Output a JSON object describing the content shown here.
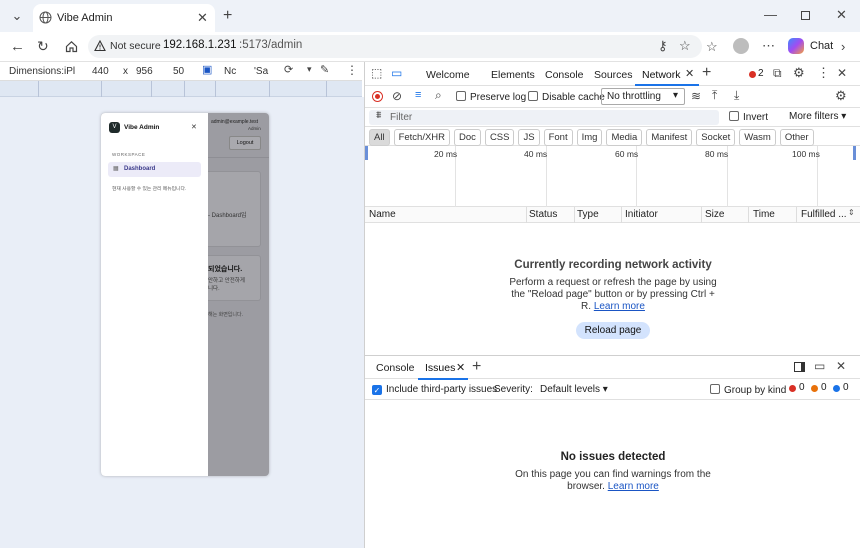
{
  "browser": {
    "tab_title": "Vibe Admin",
    "security_label": "Not secure",
    "url_host": "192.168.1.231",
    "url_rest": ":5173/admin",
    "chat_label": "Chat"
  },
  "device_toolbar": {
    "dimensions_label": "Dimensions:",
    "device": "iPl",
    "width": "440",
    "times": "x",
    "height": "956",
    "zoom": "50",
    "net": "Nc",
    "ua": "'Sa"
  },
  "app": {
    "brand": "Vibe Admin",
    "section_label": "WORKSPACE",
    "nav_item": "Dashboard",
    "drawer_note": "현재 사용할 수 있는 관리 메뉴입니다.",
    "user_email": "admin@example.test",
    "user_role": "Admin",
    "logout_label": "Logout",
    "card1_text": "- Dashboard입",
    "card2_title": "되었습니다.",
    "card2_line1": "안하고 안전하게",
    "card2_line2": "니다.",
    "footer_text": "해는 화면입니다."
  },
  "devtools": {
    "tabs": [
      "Welcome",
      "Elements",
      "Console",
      "Sources",
      "Network"
    ],
    "active_tab": "Network",
    "error_count": "2",
    "preserve_log": "Preserve log",
    "disable_cache": "Disable cache",
    "throttling": "No throttling",
    "filter_placeholder": "Filter",
    "invert": "Invert",
    "more_filters": "More filters",
    "type_filters": [
      "All",
      "Fetch/XHR",
      "Doc",
      "CSS",
      "JS",
      "Font",
      "Img",
      "Media",
      "Manifest",
      "Socket",
      "Wasm",
      "Other"
    ],
    "timeline_ticks": [
      "20 ms",
      "40 ms",
      "60 ms",
      "80 ms",
      "100 ms"
    ],
    "columns": [
      "Name",
      "Status",
      "Type",
      "Initiator",
      "Size",
      "Time",
      "Fulfilled ..."
    ],
    "recording_title": "Currently recording network activity",
    "recording_line1": "Perform a request or refresh the page by using",
    "recording_line2": "the \"Reload page\" button or by pressing Ctrl +",
    "recording_line3_pre": "R.",
    "learn_more": "Learn more",
    "reload_button": "Reload page",
    "drawer_tabs": [
      "Console",
      "Issues"
    ],
    "include_third_party": "Include third-party issues",
    "severity_label": "Severity:",
    "severity_value": "Default levels",
    "group_by_kind": "Group by kind",
    "issue_counts": [
      "0",
      "0",
      "0"
    ],
    "issues_title": "No issues detected",
    "issues_line1": "On this page you can find warnings from the",
    "issues_line2_pre": "browser.",
    "issues_learn_more": "Learn more"
  },
  "colors": {
    "accent": "#1a73e8",
    "drawer_active": "#ecebf8",
    "error": "#d93025",
    "warn": "#e8710a",
    "info": "#1a73e8"
  }
}
